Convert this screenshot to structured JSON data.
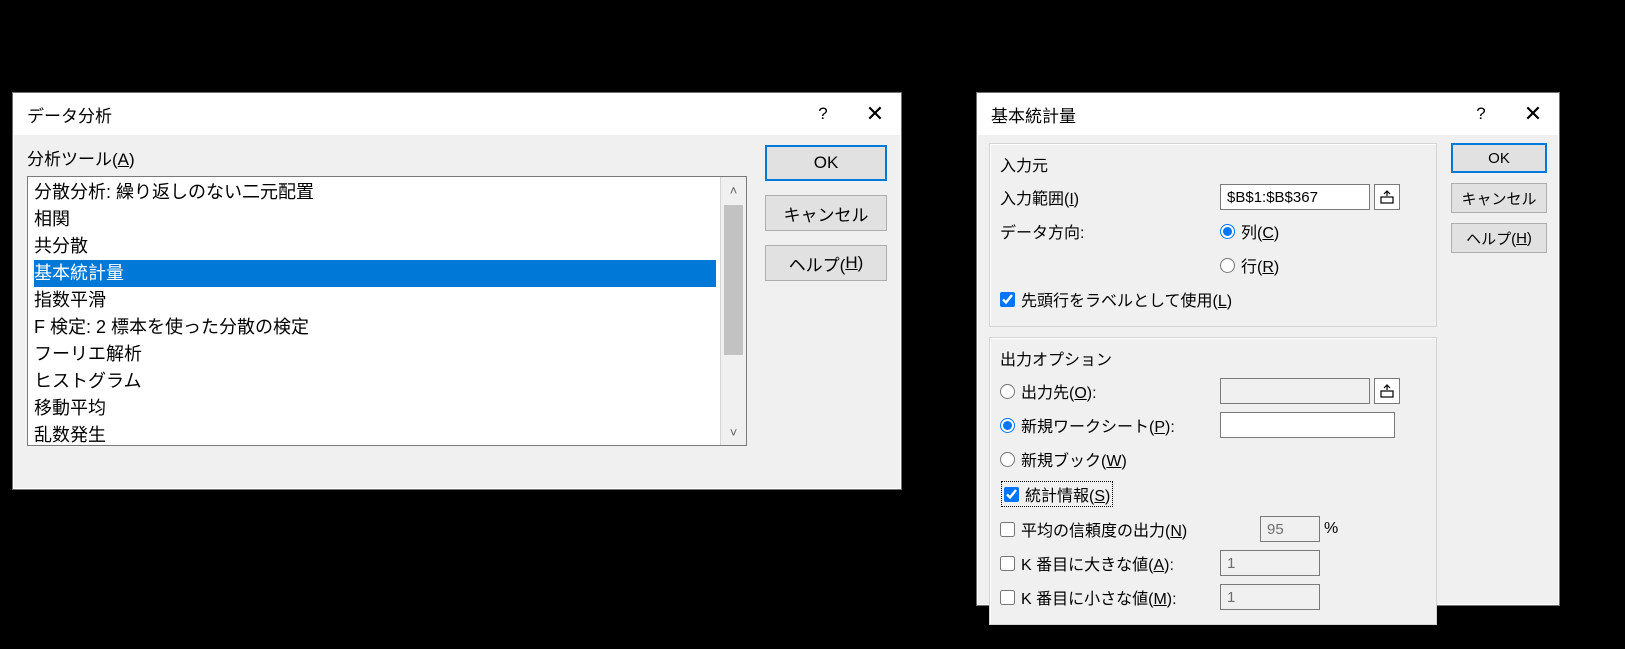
{
  "dialog1": {
    "title": "データ分析",
    "tools_label_pre": "分析ツール(",
    "tools_label_key": "A",
    "tools_label_post": ")",
    "items": [
      "分散分析: 繰り返しのない二元配置",
      "相関",
      "共分散",
      "基本統計量",
      "指数平滑",
      "F 検定:  2 標本を使った分散の検定",
      "フーリエ解析",
      "ヒストグラム",
      "移動平均",
      "乱数発生"
    ],
    "selected_index": 3,
    "ok": "OK",
    "cancel": "キャンセル",
    "help_pre": "ヘルプ(",
    "help_key": "H",
    "help_post": ")"
  },
  "dialog2": {
    "title": "基本統計量",
    "input_section": "入力元",
    "input_range_pre": "入力範囲(",
    "input_range_key": "I",
    "input_range_post": ")",
    "input_range_value": "$B$1:$B$367",
    "data_dir_label": "データ方向:",
    "col_pre": "列(",
    "col_key": "C",
    "col_post": ")",
    "row_pre": "行(",
    "row_key": "R",
    "row_post": ")",
    "labels_pre": "先頭行をラベルとして使用(",
    "labels_key": "L",
    "labels_post": ")",
    "output_section": "出力オプション",
    "out_range_pre": "出力先(",
    "out_range_key": "O",
    "out_range_post": "):",
    "new_ws_pre": "新規ワークシート(",
    "new_ws_key": "P",
    "new_ws_post": "):",
    "new_wb_pre": "新規ブック(",
    "new_wb_key": "W",
    "new_wb_post": ")",
    "stats_pre": "統計情報(",
    "stats_key": "S",
    "stats_post": ")",
    "conf_pre": "平均の信頼度の出力(",
    "conf_key": "N",
    "conf_post": ")",
    "conf_value": "95",
    "percent": "%",
    "kth_large_pre": "K 番目に大きな値(",
    "kth_large_key": "A",
    "kth_large_post": "):",
    "kth_large_value": "1",
    "kth_small_pre": "K 番目に小さな値(",
    "kth_small_key": "M",
    "kth_small_post": "):",
    "kth_small_value": "1",
    "ok": "OK",
    "cancel": "キャンセル",
    "help_pre": "ヘルプ(",
    "help_key": "H",
    "help_post": ")"
  }
}
